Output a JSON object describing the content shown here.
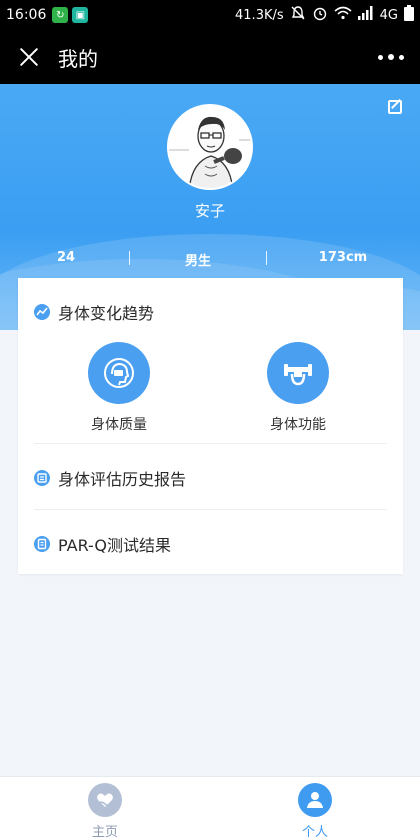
{
  "status_bar": {
    "time": "16:06",
    "speed": "41.3K/s",
    "network": "4G"
  },
  "title_bar": {
    "title": "我的"
  },
  "profile": {
    "name": "安子",
    "age": "24",
    "gender": "男生",
    "height": "173cm"
  },
  "body_trend": {
    "title": "身体变化趋势",
    "tiles": [
      {
        "label": "身体质量",
        "icon": "body-scan-icon"
      },
      {
        "label": "身体功能",
        "icon": "dumbbell-icon"
      }
    ]
  },
  "menu": {
    "history_report": "身体评估历史报告",
    "parq_result": "PAR-Q测试结果"
  },
  "bottom_nav": {
    "items": [
      {
        "label": "主页",
        "icon": "heart-hand-icon",
        "active": false
      },
      {
        "label": "个人",
        "icon": "person-icon",
        "active": true
      }
    ]
  },
  "colors": {
    "primary": "#3f9bf0",
    "header_bg": "#4aa9f5",
    "inactive_nav": "#b3bfd4",
    "page_bg": "#f2f6fb"
  }
}
